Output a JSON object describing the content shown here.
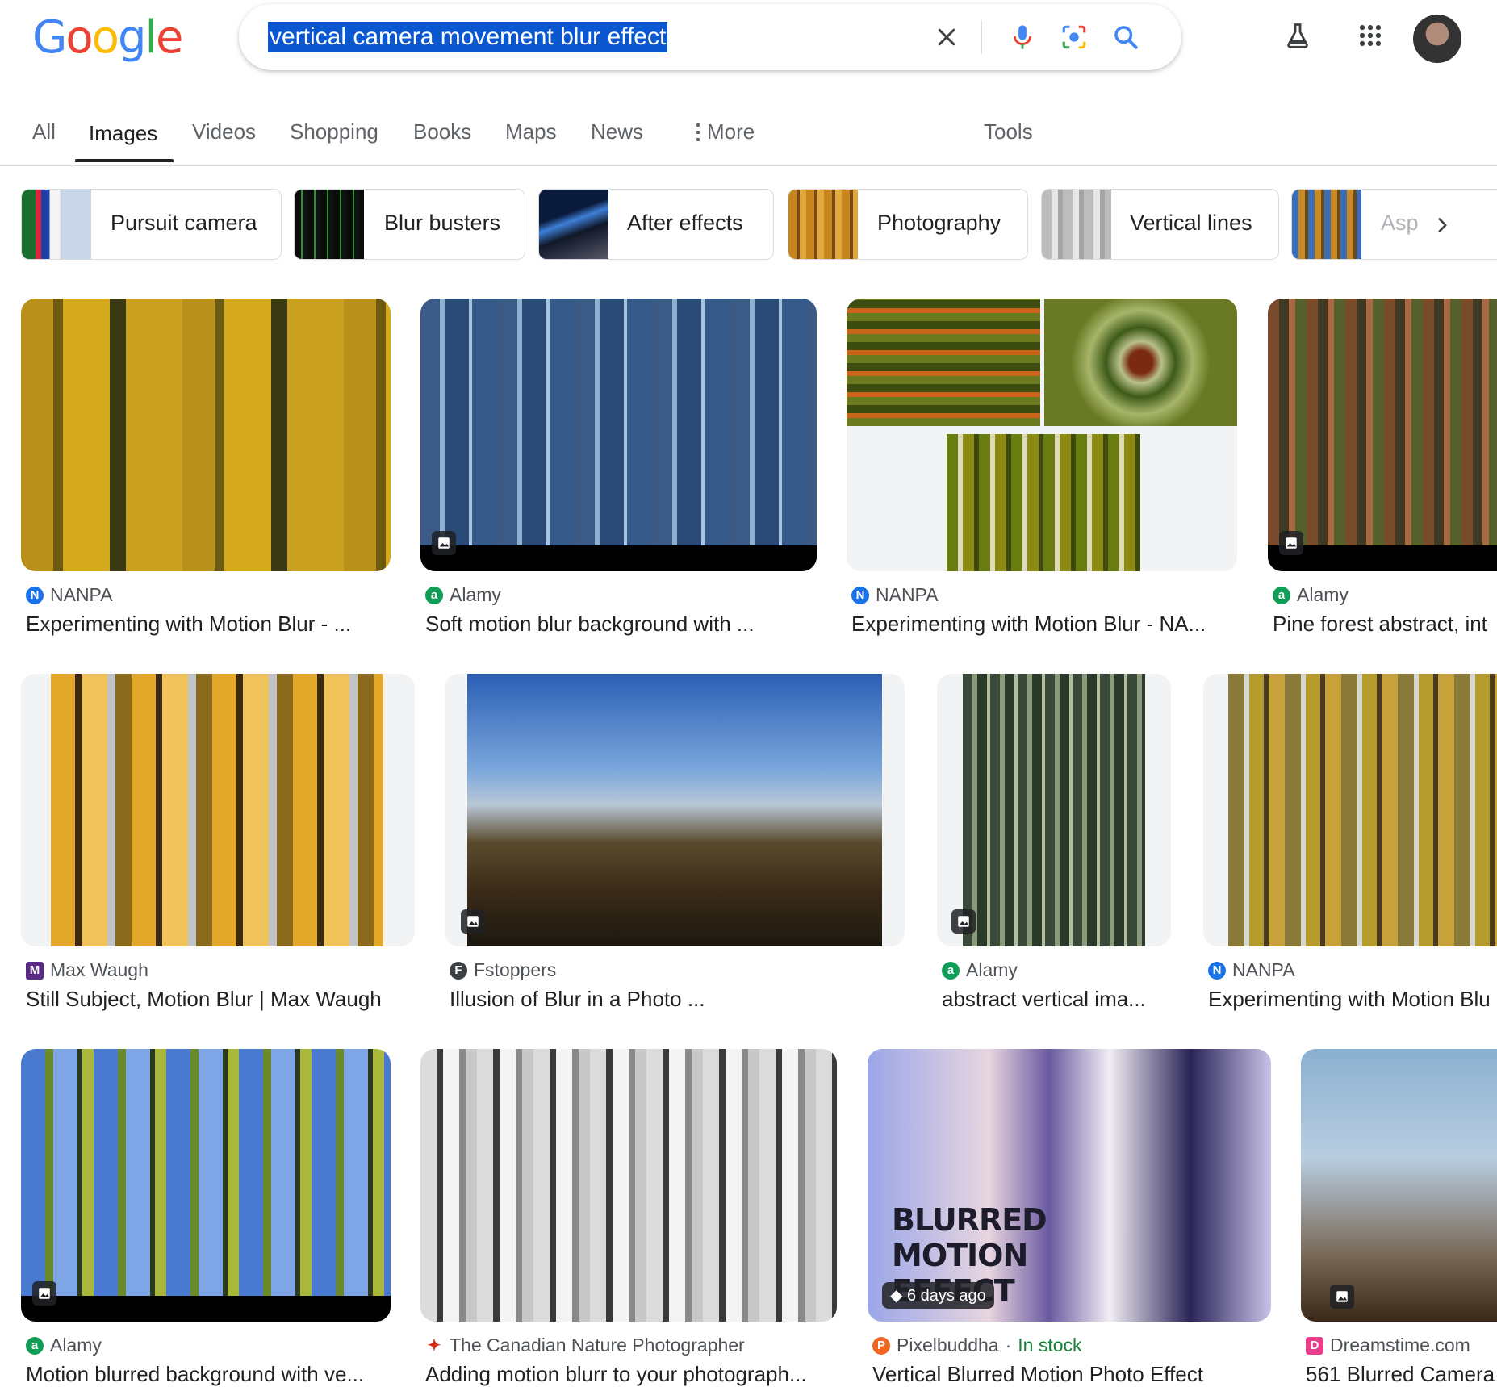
{
  "logo": [
    "G",
    "o",
    "o",
    "g",
    "l",
    "e"
  ],
  "search": {
    "query": "vertical camera movement blur effect"
  },
  "icons": {
    "clear": "close-icon",
    "voice": "microphone-icon",
    "lens": "camera-lens-icon",
    "search": "search-icon",
    "labs": "flask-icon",
    "apps": "apps-grid-icon"
  },
  "tabs": [
    "All",
    "Images",
    "Videos",
    "Shopping",
    "Books",
    "Maps",
    "News",
    "More",
    "Tools"
  ],
  "chips": [
    "Pursuit camera",
    "Blur busters",
    "After effects",
    "Photography",
    "Vertical lines",
    "Asp"
  ],
  "results": [
    {
      "source": "NANPA",
      "title": "Experimenting with Motion Blur - ..."
    },
    {
      "source": "Alamy",
      "title": "Soft motion blur background with ..."
    },
    {
      "source": "NANPA",
      "title": "Experimenting with Motion Blur - NA..."
    },
    {
      "source": "Alamy",
      "title": "Pine forest abstract, int"
    },
    {
      "source": "Max Waugh",
      "title": "Still Subject, Motion Blur | Max Waugh"
    },
    {
      "source": "Fstoppers",
      "title": "Illusion of Blur in a Photo ..."
    },
    {
      "source": "Alamy",
      "title": "abstract vertical ima..."
    },
    {
      "source": "NANPA",
      "title": "Experimenting with Motion Blu"
    },
    {
      "source": "Alamy",
      "title": "Motion blurred background with ve..."
    },
    {
      "source": "The Canadian Nature Photographer",
      "title": "Adding motion blurr to your photograph..."
    },
    {
      "source": "Pixelbuddha",
      "stock": "In stock",
      "title": "Vertical Blurred Motion Photo Effect",
      "badge": "6 days ago",
      "poster": [
        "BLURRED",
        "MOTION",
        "EFFECT"
      ]
    },
    {
      "source": "Dreamstime.com",
      "title": "561 Blurred Camera"
    }
  ],
  "colors": {
    "accent": "#0b57d0",
    "in_stock": "#188038"
  }
}
